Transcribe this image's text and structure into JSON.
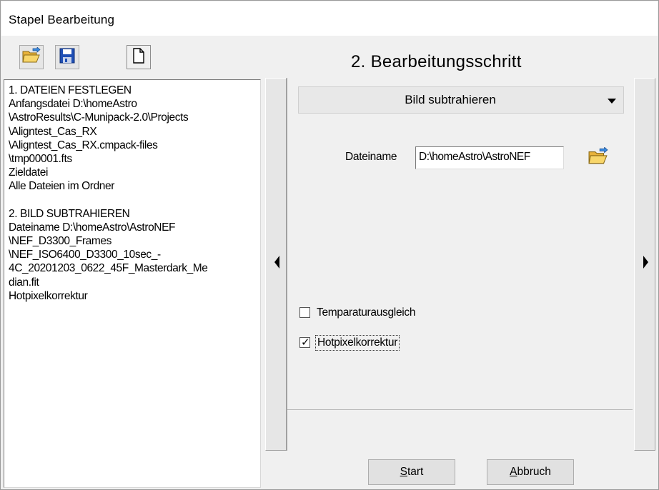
{
  "window": {
    "title": "Stapel Bearbeitung"
  },
  "toolbar": {
    "open_icon": "open-folder-icon",
    "save_icon": "floppy-disk-save-icon",
    "new_icon": "new-document-icon"
  },
  "left_panel": {
    "lines": [
      "1. DATEIEN FESTLEGEN",
      "Anfangsdatei   D:\\homeAstro",
      "\\AstroResults\\C-Munipack-2.0\\Projects",
      "\\Aligntest_Cas_RX",
      "\\Aligntest_Cas_RX.cmpack-files",
      "\\tmp00001.fts",
      "Zieldatei",
      "Alle Dateien im Ordner",
      "",
      "2. BILD SUBTRAHIEREN",
      "Dateiname    D:\\homeAstro\\AstroNEF",
      "\\NEF_D3300_Frames",
      "\\NEF_ISO6400_D3300_10sec_-",
      "4C_20201203_0622_45F_Masterdark_Me",
      "dian.fit",
      "Hotpixelkorrektur"
    ]
  },
  "step": {
    "title": "2. Bearbeitungsschritt"
  },
  "operation_select": {
    "selected": "Bild subtrahieren"
  },
  "file": {
    "label": "Dateiname",
    "value": "D:\\homeAstro\\AstroNEF",
    "browse_icon": "open-folder-icon"
  },
  "options": {
    "temperature": {
      "label": "Temparaturausgleich",
      "checked": false
    },
    "hotpixel": {
      "label": "Hotpixelkorrektur",
      "checked": true
    }
  },
  "buttons": {
    "start_underlined": "S",
    "start_rest": "tart",
    "cancel_underlined": "A",
    "cancel_rest": "bbruch"
  },
  "colors": {
    "window_bg": "#f0f0f0",
    "folder_yellow": "#f5c542",
    "floppy_blue": "#1f4fb5"
  }
}
